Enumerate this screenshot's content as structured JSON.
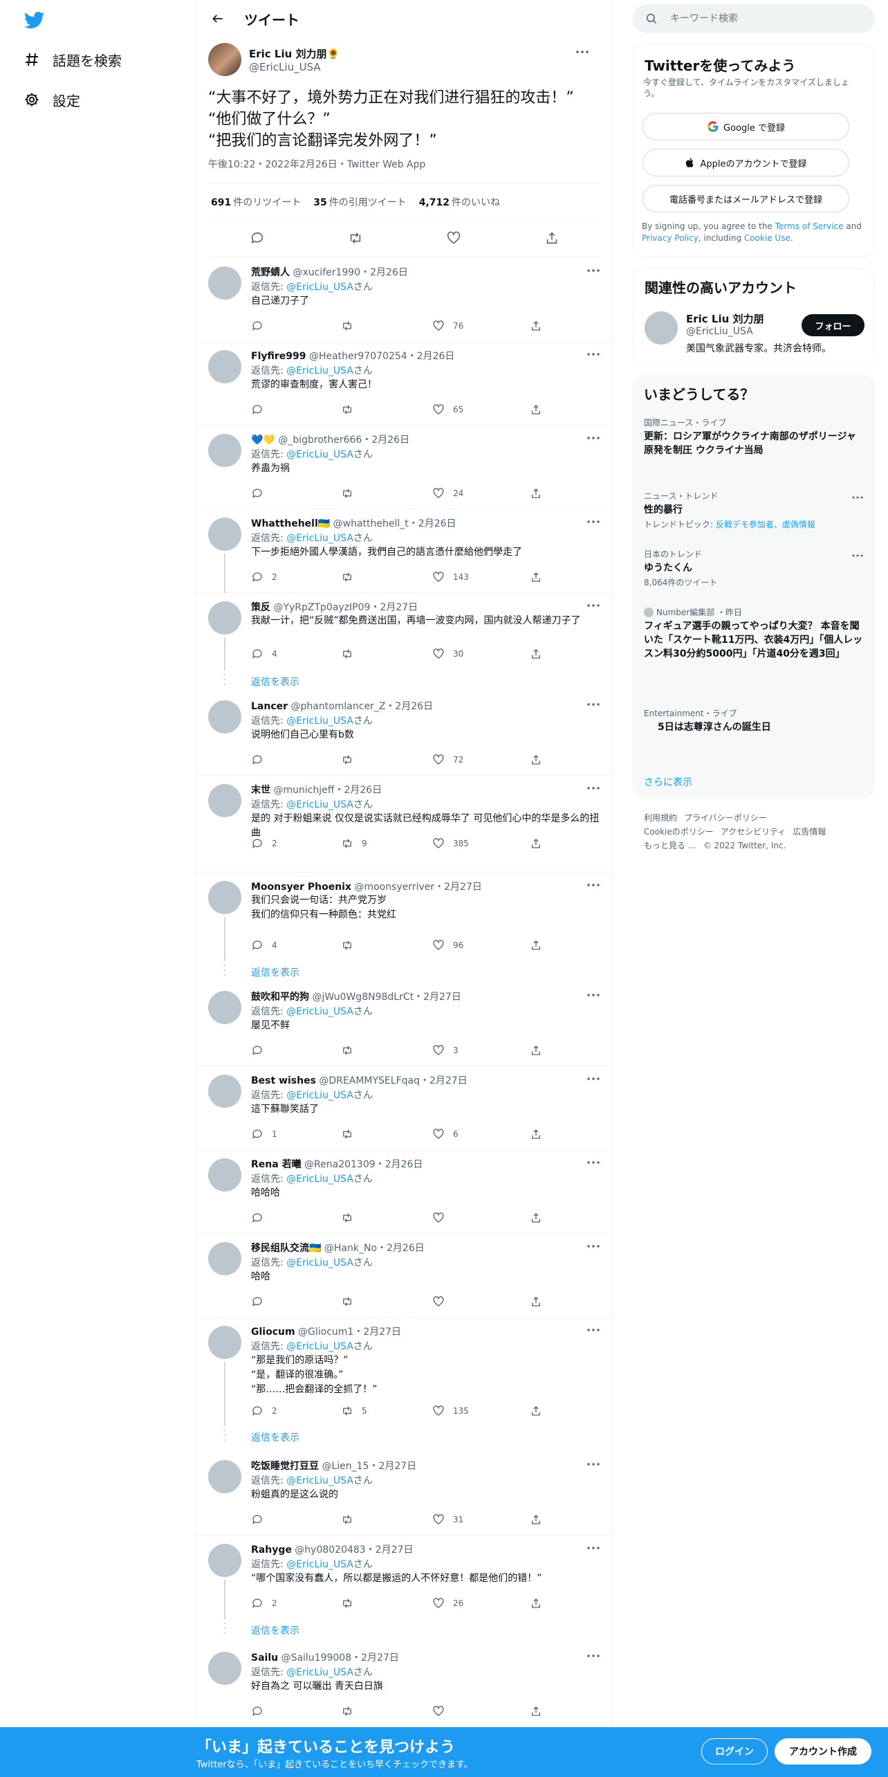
{
  "nav": {
    "explore_label": "話題を検索",
    "settings_label": "設定"
  },
  "header": {
    "title": "ツイート"
  },
  "focal": {
    "name": "Eric Liu 刘力朋🌻",
    "handle": "@EricLiu_USA",
    "text": "“大事不好了，境外势力正在对我们进行猖狂的攻击！”\n“他们做了什么？”\n“把我们的言论翻译完发外网了！”",
    "meta": "午後10:22・2022年2月26日・Twitter Web App",
    "stats": {
      "retweets_count": "691",
      "retweets_label": "件のリツイート",
      "quotes_count": "35",
      "quotes_label": "件の引用ツイート",
      "likes_count": "4,712",
      "likes_label": "件のいいね"
    }
  },
  "reply_prefix": "返信先: ",
  "reply_suffix": "さん",
  "show_replies_label": "返信を表示",
  "replies": [
    {
      "name": "荒野蜻人",
      "handle": "@xucifer1990",
      "date": "2月26日",
      "to": "@EricLiu_USA",
      "text": "自己递刀子了",
      "replies": "",
      "retweets": "",
      "likes": "76"
    },
    {
      "name": "Flyfire999",
      "handle": "@Heather97070254",
      "date": "2月26日",
      "to": "@EricLiu_USA",
      "text": "荒谬的审查制度，害人害己！",
      "replies": "",
      "retweets": "",
      "likes": "65"
    },
    {
      "name": "💙💛",
      "handle": "@_bigbrother666",
      "date": "2月26日",
      "to": "@EricLiu_USA",
      "text": "养蛊为祸",
      "replies": "",
      "retweets": "",
      "likes": "24"
    },
    {
      "name": "Whatthehell🇺🇦",
      "handle": "@whatthehell_t",
      "date": "2月26日",
      "to": "@EricLiu_USA",
      "text": "下一步拒絕外國人學漢語，我們自己的語言憑什麼給他們學走了",
      "replies": "2",
      "retweets": "",
      "likes": "143"
    },
    {
      "name": "策反",
      "handle": "@YyRpZTp0ayzIP09",
      "date": "2月27日",
      "to": "",
      "text": "我献一计，把“反贼”都免费送出国，再墙一波变内网，国内就没人帮递刀子了",
      "replies": "4",
      "retweets": "",
      "likes": "30"
    },
    {
      "name": "Lancer",
      "handle": "@phantomlancer_Z",
      "date": "2月26日",
      "to": "@EricLiu_USA",
      "text": "说明他们自己心里有b数",
      "replies": "",
      "retweets": "",
      "likes": "72"
    },
    {
      "name": "末世",
      "handle": "@munichjeff",
      "date": "2月26日",
      "to": "@EricLiu_USA",
      "text": "是的 对于粉蛆来说 仅仅是说实话就已经构成辱华了 可见他们心中的华是多么的扭曲",
      "replies": "2",
      "retweets": "9",
      "likes": "385"
    },
    {
      "name": "Moonsyer Phoenix",
      "handle": "@moonsyerriver",
      "date": "2月27日",
      "to": "",
      "text": "我们只会说一句话：共产党万岁\n我们的信仰只有一种颜色：共党红",
      "replies": "4",
      "retweets": "",
      "likes": "96"
    },
    {
      "name": "鼓吹和平的狗",
      "handle": "@jWu0Wg8N98dLrCt",
      "date": "2月27日",
      "to": "@EricLiu_USA",
      "text": "屡见不鲜",
      "replies": "",
      "retweets": "",
      "likes": "3"
    },
    {
      "name": "Best wishes",
      "handle": "@DREAMMYSELFqaq",
      "date": "2月27日",
      "to": "@EricLiu_USA",
      "text": "這下蘇聯笑話了",
      "replies": "1",
      "retweets": "",
      "likes": "6"
    },
    {
      "name": "Rena 若曦",
      "handle": "@Rena201309",
      "date": "2月26日",
      "to": "@EricLiu_USA",
      "text": "哈哈哈",
      "replies": "",
      "retweets": "",
      "likes": ""
    },
    {
      "name": "移民组队交流🇺🇦",
      "handle": "@Hank_No",
      "date": "2月26日",
      "to": "@EricLiu_USA",
      "text": "哈哈",
      "replies": "",
      "retweets": "",
      "likes": ""
    },
    {
      "name": "Gliocum",
      "handle": "@Gliocum1",
      "date": "2月27日",
      "to": "@EricLiu_USA",
      "text": "“那是我们的原话吗？”\n“是，翻译的很准确。”\n“那……把会翻译的全抓了！”",
      "replies": "2",
      "retweets": "5",
      "likes": "135"
    },
    {
      "name": "吃饭睡觉打豆豆",
      "handle": "@Lien_15",
      "date": "2月27日",
      "to": "@EricLiu_USA",
      "text": "粉蛆真的是这么说的",
      "replies": "",
      "retweets": "",
      "likes": "31"
    },
    {
      "name": "Rahyge",
      "handle": "@hy08020483",
      "date": "2月27日",
      "to": "@EricLiu_USA",
      "text": "“哪个国家没有蠢人，所以都是搬运的人不怀好意！都是他们的错！”",
      "replies": "2",
      "retweets": "",
      "likes": "26"
    },
    {
      "name": "Sailu",
      "handle": "@Sailu199008",
      "date": "2月27日",
      "to": "@EricLiu_USA",
      "text": "好自為之 可以曬出 青天白日旗",
      "replies": "",
      "retweets": "",
      "likes": ""
    }
  ],
  "sidebar": {
    "search_placeholder": "キーワード検索",
    "signup": {
      "title": "Twitterを使ってみよう",
      "subtitle": "今すぐ登録して、タイムラインをカスタマイズしましょう。",
      "google": "Google で登録",
      "apple": "Appleのアカウントで登録",
      "phone": "電話番号またはメールアドレスで登録",
      "terms_pre": "By signing up, you agree to the ",
      "terms_link": "Terms of Service",
      "terms_and": " and ",
      "privacy_link": "Privacy Policy",
      "terms_mid": ", including ",
      "cookie_link": "Cookie Use",
      "terms_end": "."
    },
    "relevant": {
      "title": "関連性の高いアカウント",
      "name": "Eric Liu 刘力朋",
      "handle": "@EricLiu_USA",
      "bio": "美国气象武器专家。共济会特师。",
      "follow": "フォロー"
    },
    "trends": {
      "title": "いまどうしてる？",
      "items": [
        {
          "cat": "国際ニュース・ライブ",
          "title": "更新：ロシア軍がウクライナ南部のザポリージャ原発を制圧 ウクライナ当局",
          "sub": ""
        },
        {
          "cat": "ニュース・トレンド",
          "title": "性的暴行",
          "sub_pre": "トレンドトピック: ",
          "sub_link": "反戦デモ参加者、虐偽情報"
        },
        {
          "cat": "日本のトレンド",
          "title": "ゆうたくん",
          "sub": "8,064件のツイート"
        },
        {
          "cat": "Number編集部 ・昨日",
          "title": "フィギュア選手の親ってやっぱり大変？ 本音を聞いた「スケート靴11万円、衣装4万円」「個人レッスン料30分約5000円」「片道40分を週3回」",
          "sub": ""
        },
        {
          "cat": "Entertainment・ライブ",
          "title": "5日は志尊淳さんの誕生日",
          "sub": ""
        }
      ],
      "more": "さらに表示"
    },
    "footer": [
      "利用規約",
      "プライバシーポリシー",
      "Cookieのポリシー",
      "アクセシビリティ",
      "広告情報",
      "もっと見る …",
      "© 2022 Twitter, Inc."
    ]
  },
  "bottombar": {
    "title": "「いま」起きていることを見つけよう",
    "subtitle": "Twitterなら、「いま」起きていることをいち早くチェックできます。",
    "login": "ログイン",
    "signup": "アカウント作成"
  },
  "colors": {
    "accent": "#1d9bf0",
    "text": "#0f1419",
    "muted": "#536471"
  }
}
